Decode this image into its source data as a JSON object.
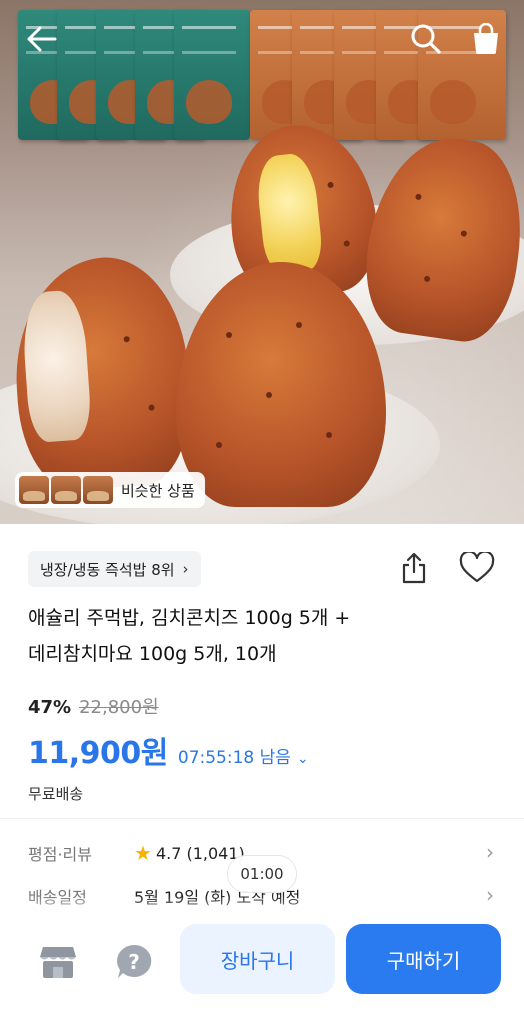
{
  "similar": {
    "label": "비슷한 상품"
  },
  "ranking": {
    "label": "냉장/냉동 즉석밥 8위",
    "chevron": "›"
  },
  "product": {
    "title_line1": "애슐리 주먹밥, 김치콘치즈 100g 5개 +",
    "title_line2": "데리참치마요 100g 5개, 10개",
    "discount": "47%",
    "original_price": "22,800원",
    "price": "11,900원",
    "timer": "07:55:18 남음",
    "timer_chevron": "⌄",
    "shipping": "무료배송"
  },
  "details": {
    "rating_label": "평점·리뷰",
    "rating_value": "4.7 (1,041)",
    "delivery_label": "배송일정",
    "delivery_value": "5월 19일 (화) 도착 예정"
  },
  "timestamp": "01:00",
  "actions": {
    "cart_label": "장바구니",
    "buy_label": "구매하기"
  },
  "icons": {
    "back": "arrow-left-icon",
    "search": "search-icon",
    "cart": "shopping-bag-icon",
    "share": "share-icon",
    "like": "heart-icon",
    "store": "store-icon",
    "help": "question-icon",
    "star": "star-icon"
  },
  "colors": {
    "accent": "#2a76e8",
    "buy_button": "#2a7af0",
    "cart_button_bg": "#eaf3ff",
    "star": "#f5b400"
  }
}
